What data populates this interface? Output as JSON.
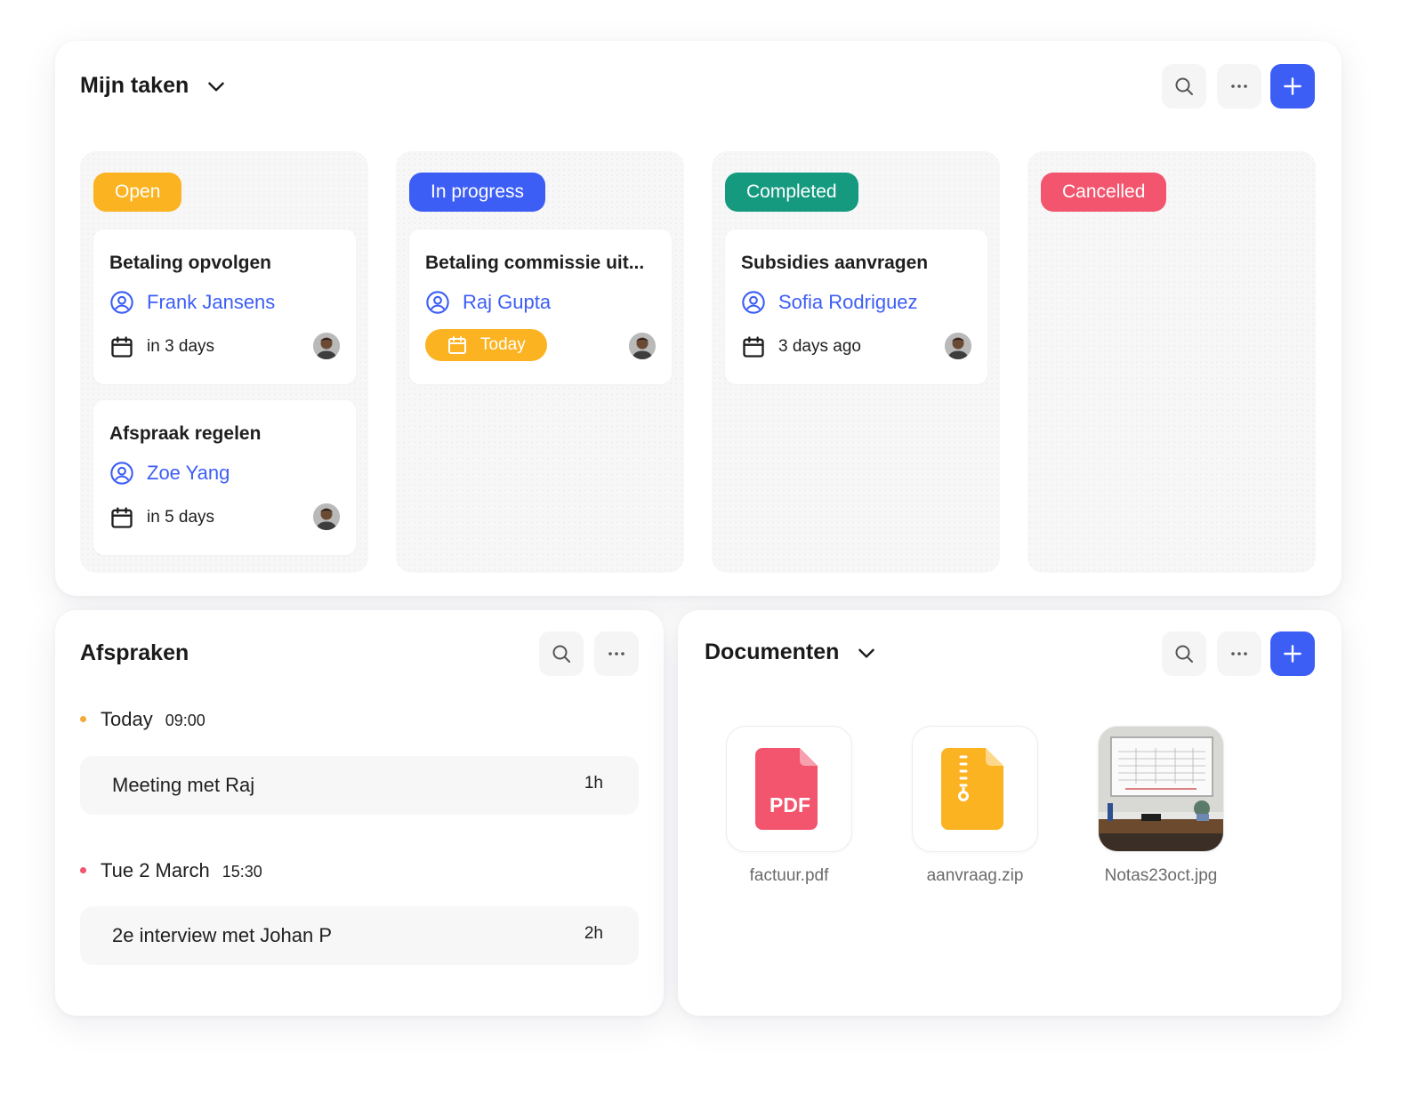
{
  "colors": {
    "accent": "#3d5ef5",
    "open": "#fbb321",
    "in_progress": "#3d5ef5",
    "completed": "#159a80",
    "cancelled": "#f2556d",
    "dot_today": "#f6a93b",
    "dot_march": "#f2556d"
  },
  "tasks": {
    "title": "Mijn taken",
    "icons": [
      "chevron-down-icon",
      "search-icon",
      "more-icon",
      "plus-icon"
    ],
    "columns": [
      {
        "status": "Open",
        "cards": [
          {
            "title": "Betaling opvolgen",
            "assignee": "Frank Jansens",
            "due": "in 3 days"
          },
          {
            "title": "Afspraak regelen",
            "assignee": "Zoe Yang",
            "due": "in 5 days"
          }
        ]
      },
      {
        "status": "In progress",
        "cards": [
          {
            "title": "Betaling commissie uit...",
            "assignee": "Raj Gupta",
            "due": "Today"
          }
        ]
      },
      {
        "status": "Completed",
        "cards": [
          {
            "title": "Subsidies aanvragen",
            "assignee": "Sofia Rodriguez",
            "due": "3 days ago"
          }
        ]
      },
      {
        "status": "Cancelled",
        "cards": []
      }
    ]
  },
  "appointments": {
    "title": "Afspraken",
    "groups": [
      {
        "day": "Today",
        "time": "09:00",
        "items": [
          {
            "title": "Meeting met Raj",
            "duration": "1h"
          }
        ]
      },
      {
        "day": "Tue 2 March",
        "time": "15:30",
        "items": [
          {
            "title": "2e interview met Johan P",
            "duration": "2h"
          }
        ]
      }
    ]
  },
  "documents": {
    "title": "Documenten",
    "files": [
      {
        "name": "factuur.pdf",
        "icon": "pdf-file-icon",
        "label": "PDF"
      },
      {
        "name": "aanvraag.zip",
        "icon": "zip-file-icon"
      },
      {
        "name": "Notas23oct.jpg",
        "icon": "image-thumbnail"
      }
    ]
  }
}
